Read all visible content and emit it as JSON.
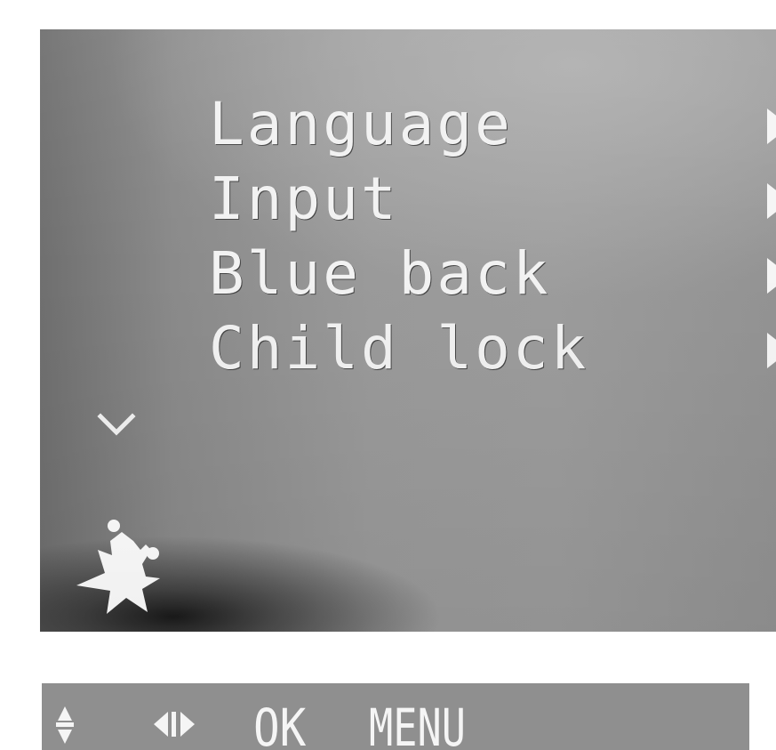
{
  "menu": {
    "items": [
      {
        "label": "Language",
        "has_submenu": true
      },
      {
        "label": "Input",
        "has_submenu": true
      },
      {
        "label": "Blue back",
        "has_submenu": true
      },
      {
        "label": "Child lock",
        "has_submenu": true
      }
    ],
    "scroll_icon": "chevron-down-icon",
    "logo_icon": "star-figure-icon"
  },
  "nav_bar": {
    "up_down_icon": "up-down-arrows-icon",
    "left_right_icon": "left-right-arrows-icon",
    "ok_label": "OK",
    "menu_label": "MENU"
  },
  "colors": {
    "panel": "#9a9a9a",
    "text": "#f2f2f2",
    "nav_bar": "#8f8f8f"
  }
}
